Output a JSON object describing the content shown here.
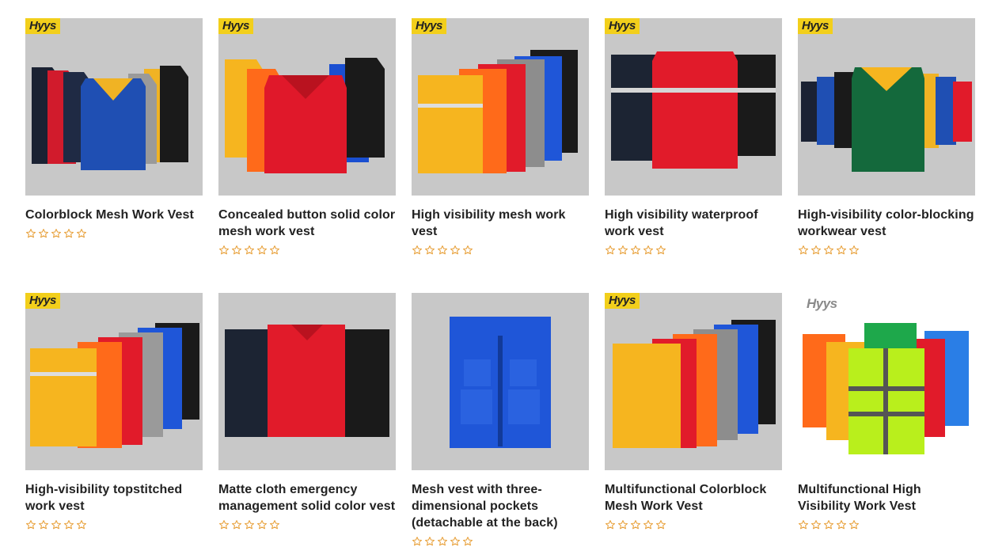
{
  "brand": "Hyys",
  "products": [
    {
      "title": "Colorblock Mesh Work Vest",
      "rating": 0,
      "stars": 5
    },
    {
      "title": "Concealed button solid color mesh work vest",
      "rating": 0,
      "stars": 5
    },
    {
      "title": "High visibility mesh work vest",
      "rating": 0,
      "stars": 5
    },
    {
      "title": "High visibility waterproof work vest",
      "rating": 0,
      "stars": 5
    },
    {
      "title": "High-visibility color-blocking workwear vest",
      "rating": 0,
      "stars": 5
    },
    {
      "title": "High-visibility topstitched work vest",
      "rating": 0,
      "stars": 5
    },
    {
      "title": "Matte cloth emergency management solid color vest",
      "rating": 0,
      "stars": 5
    },
    {
      "title": "Mesh vest with three-dimensional pockets (detachable at the back)",
      "rating": 0,
      "stars": 5
    },
    {
      "title": "Multifunctional Colorblock Mesh Work Vest",
      "rating": 0,
      "stars": 5
    },
    {
      "title": "Multifunctional High Visibility Work Vest",
      "rating": 0,
      "stars": 5
    }
  ],
  "colors": {
    "star_outline": "#e8a03a",
    "thumb_bg": "#c8c8c8",
    "brand_badge": "#f2cf1b"
  }
}
